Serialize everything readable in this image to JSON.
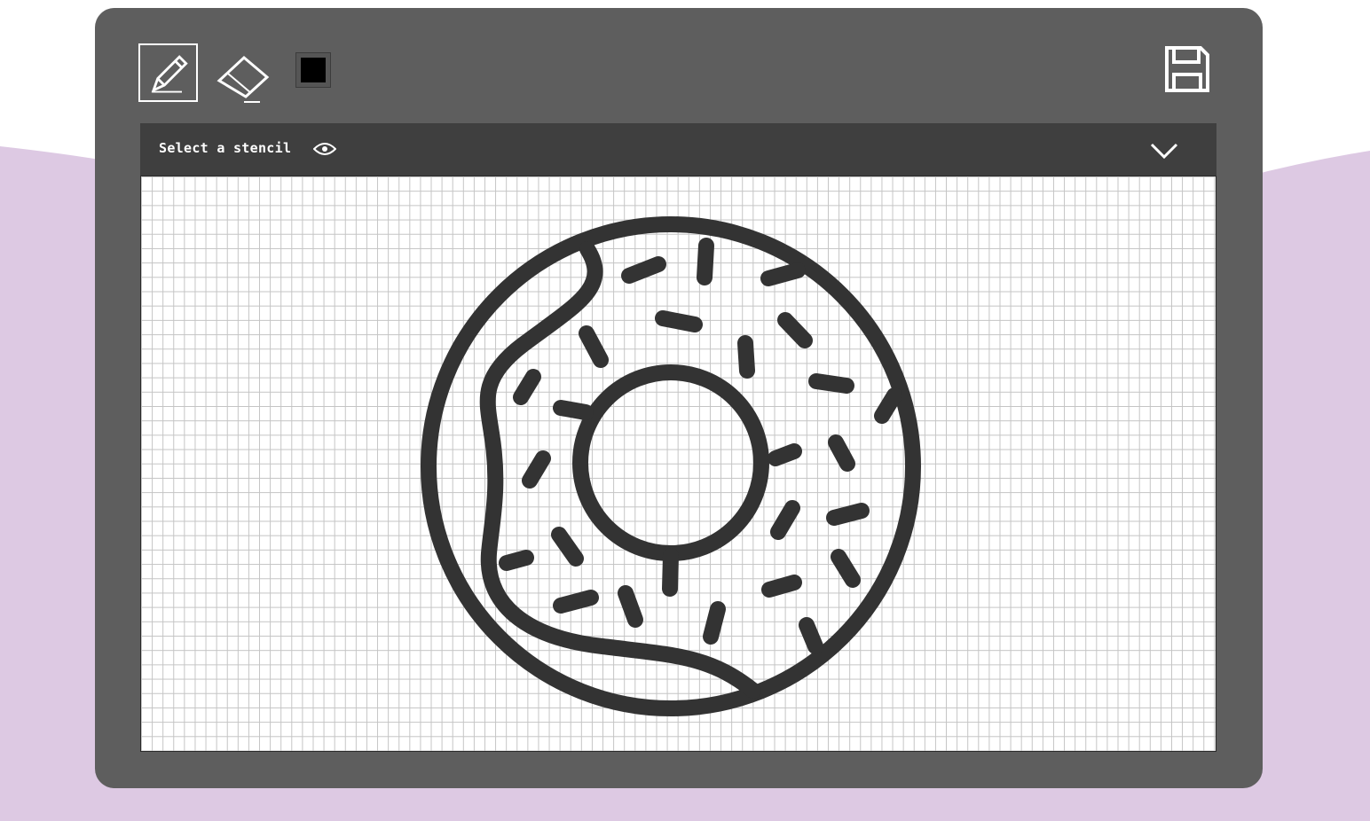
{
  "toolbar": {
    "tools": [
      {
        "name": "pencil",
        "icon": "pencil-icon",
        "selected": true
      },
      {
        "name": "eraser",
        "icon": "eraser-icon",
        "selected": false
      }
    ],
    "current_color": "#000000",
    "save_icon": "floppy-disk-icon"
  },
  "stencil": {
    "label": "Select a stencil",
    "preview_icon": "eye-icon",
    "dropdown_icon": "chevron-down-icon",
    "current_drawing": "donut-icon"
  },
  "colors": {
    "app_background": "#5e5e5e",
    "stencil_bar": "#3f3f3f",
    "page_wave": "#ddc9e3",
    "stroke": "#333333"
  }
}
